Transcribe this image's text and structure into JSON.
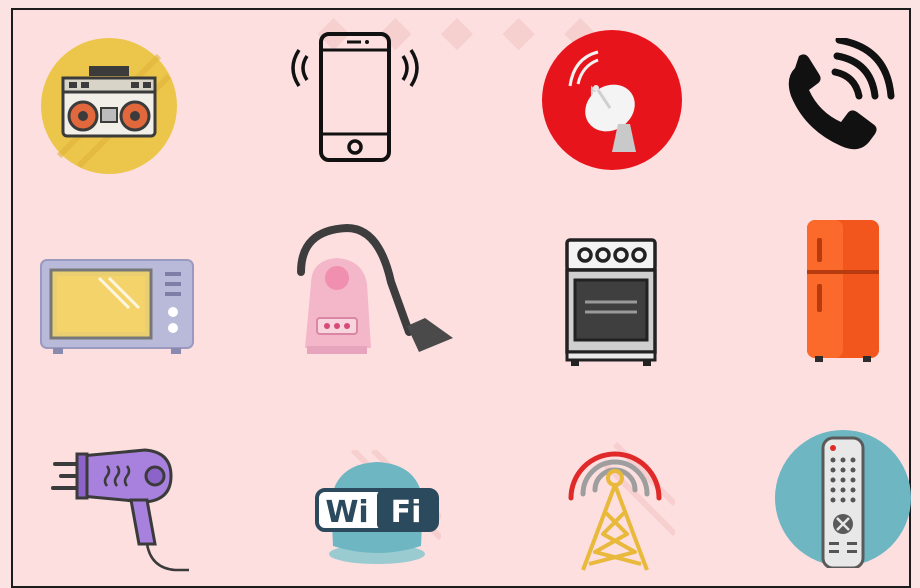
{
  "icons": [
    {
      "name": "boombox-icon"
    },
    {
      "name": "vibrating-smartphone-icon"
    },
    {
      "name": "satellite-dish-icon"
    },
    {
      "name": "ringing-telephone-icon"
    },
    {
      "name": "microwave-oven-icon"
    },
    {
      "name": "vacuum-cleaner-icon"
    },
    {
      "name": "gas-stove-oven-icon"
    },
    {
      "name": "refrigerator-icon"
    },
    {
      "name": "hair-dryer-icon"
    },
    {
      "name": "wifi-icon",
      "label_left": "Wi",
      "label_right": "Fi"
    },
    {
      "name": "radio-tower-icon"
    },
    {
      "name": "tv-remote-icon"
    }
  ],
  "colors": {
    "background": "#fddfe0",
    "border": "#1c1c1c",
    "red": "#e8141c",
    "yellow": "#ecc64a",
    "orange": "#f2561d",
    "teal": "#6eb6c2"
  }
}
